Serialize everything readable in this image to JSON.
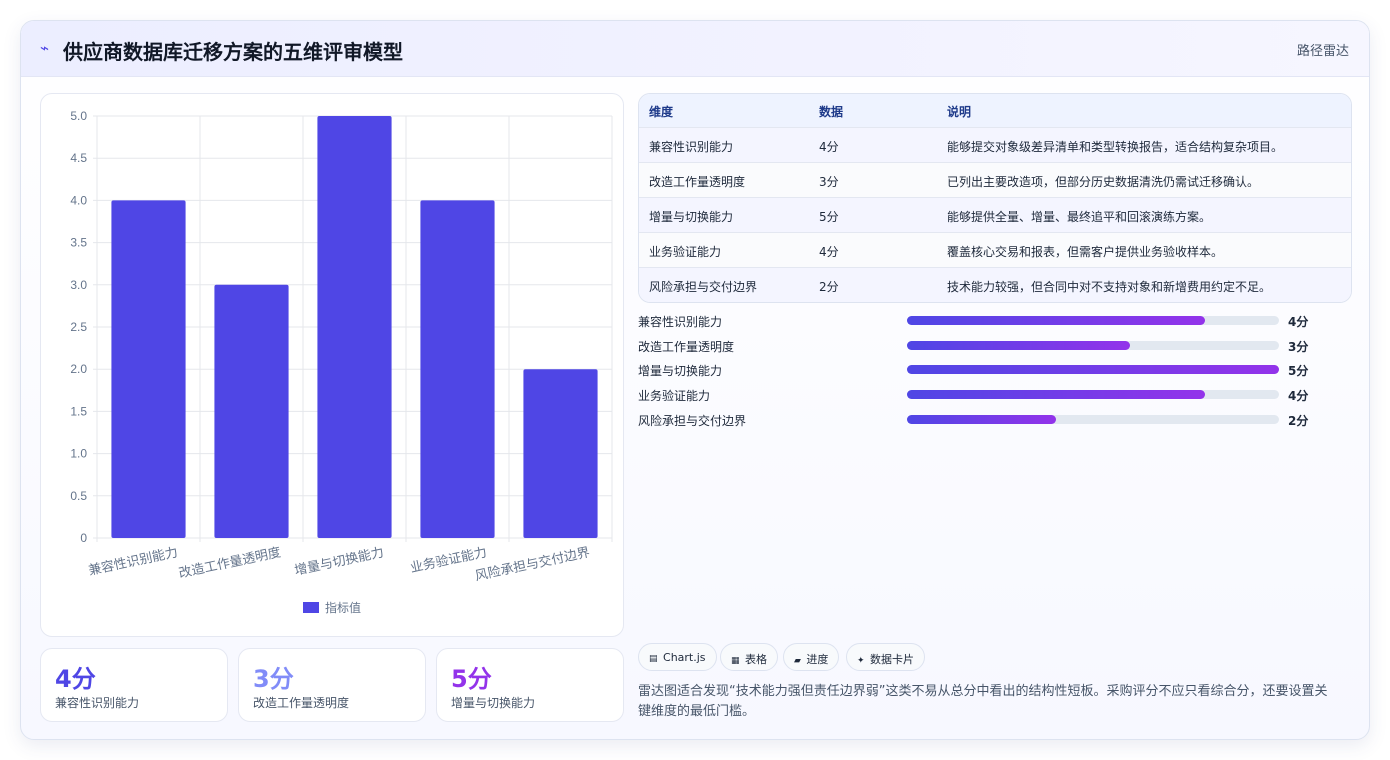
{
  "header": {
    "title": "供应商数据库迁移方案的五维评审模型",
    "tag": "路径雷达",
    "icon": "pulse-icon"
  },
  "chart_data": {
    "type": "bar",
    "categories": [
      "兼容性识别能力",
      "改造工作量透明度",
      "增量与切换能力",
      "业务验证能力",
      "风险承担与交付边界"
    ],
    "series": [
      {
        "name": "指标值",
        "values": [
          4,
          3,
          5,
          4,
          2
        ],
        "color": "#4f46e5"
      }
    ],
    "y_ticks": [
      "0",
      "0.5",
      "1.0",
      "1.5",
      "2.0",
      "2.5",
      "3.0",
      "3.5",
      "4.0",
      "4.5",
      "5.0"
    ],
    "ylim": [
      0,
      5
    ],
    "grid": true,
    "legend": "bottom"
  },
  "stats": [
    {
      "value": "4分",
      "label": "兼容性识别能力",
      "color": "#4f46e5"
    },
    {
      "value": "3分",
      "label": "改造工作量透明度",
      "color": "#818cf8"
    },
    {
      "value": "5分",
      "label": "增量与切换能力",
      "color": "#9333ea"
    }
  ],
  "table": {
    "headers": [
      "维度",
      "数据",
      "说明"
    ],
    "rows": [
      [
        "兼容性识别能力",
        "4分",
        "能够提交对象级差异清单和类型转换报告，适合结构复杂项目。"
      ],
      [
        "改造工作量透明度",
        "3分",
        "已列出主要改造项，但部分历史数据清洗仍需试迁移确认。"
      ],
      [
        "增量与切换能力",
        "5分",
        "能够提供全量、增量、最终追平和回滚演练方案。"
      ],
      [
        "业务验证能力",
        "4分",
        "覆盖核心交易和报表，但需客户提供业务验收样本。"
      ],
      [
        "风险承担与交付边界",
        "2分",
        "技术能力较强，但合同中对不支持对象和新增费用约定不足。"
      ]
    ]
  },
  "progress": [
    {
      "label": "兼容性识别能力",
      "value": 4,
      "max": 5,
      "text": "4分"
    },
    {
      "label": "改造工作量透明度",
      "value": 3,
      "max": 5,
      "text": "3分"
    },
    {
      "label": "增量与切换能力",
      "value": 5,
      "max": 5,
      "text": "5分"
    },
    {
      "label": "业务验证能力",
      "value": 4,
      "max": 5,
      "text": "4分"
    },
    {
      "label": "风险承担与交付边界",
      "value": 2,
      "max": 5,
      "text": "2分"
    }
  ],
  "chips": [
    {
      "icon": "▤",
      "icon_name": "chart-icon",
      "label": "Chart.js"
    },
    {
      "icon": "▦",
      "icon_name": "table-icon",
      "label": "表格"
    },
    {
      "icon": "▰",
      "icon_name": "progress-icon",
      "label": "进度"
    },
    {
      "icon": "✦",
      "icon_name": "card-icon",
      "label": "数据卡片"
    }
  ],
  "note": "雷达图适合发现“技术能力强但责任边界弱”这类不易从总分中看出的结构性短板。采购评分不应只看综合分，还要设置关键维度的最低门槛。"
}
